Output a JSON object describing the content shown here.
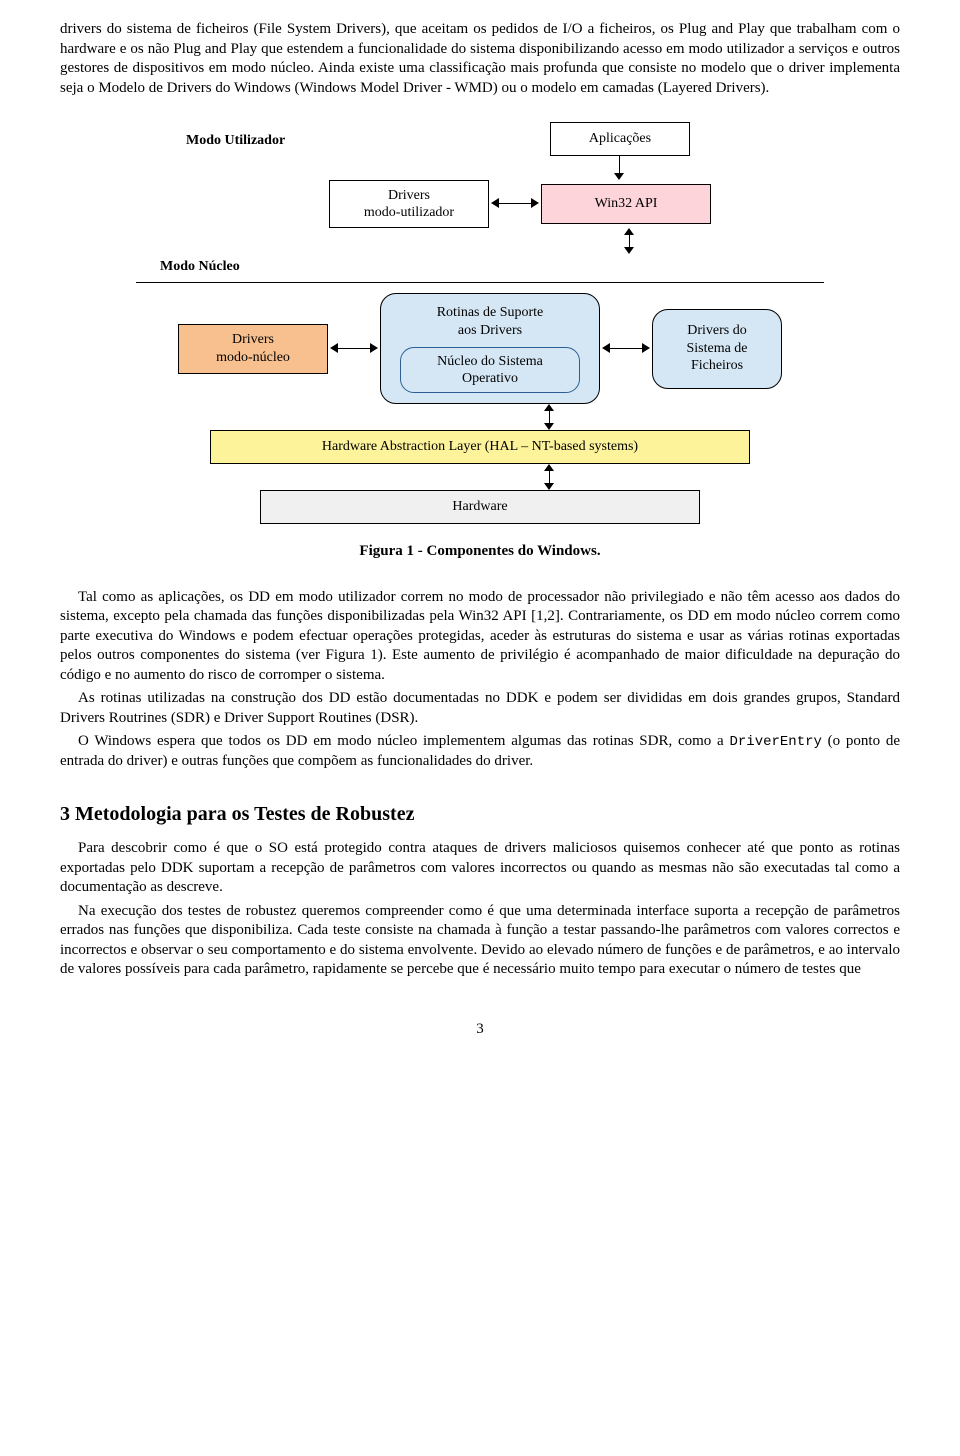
{
  "p1_first": "drivers do sistema de ficheiros (File System Drivers), que aceitam os pedidos de I/O a ficheiros, os Plug and Play que trabalham com o hardware e os não Plug and Play que estendem a funcionalidade do sistema disponibilizando acesso em modo utilizador a serviços e outros gestores de dispositivos em modo núcleo. Ainda existe uma classificação mais profunda que consiste no modelo que o driver implementa seja o Modelo de Drivers do Windows (Windows Model Driver - WMD) ou o modelo em camadas (Layered Drivers).",
  "diagram": {
    "mode_user": "Modo Utilizador",
    "mode_kernel": "Modo Núcleo",
    "apps": "Aplicações",
    "user_drivers_l1": "Drivers",
    "user_drivers_l2": "modo-utilizador",
    "win32": "Win32  API",
    "kern_drivers_l1": "Drivers",
    "kern_drivers_l2": "modo-núcleo",
    "support_l1": "Rotinas de Suporte",
    "support_l2": "aos Drivers",
    "nucleus_l1": "Núcleo do Sistema",
    "nucleus_l2": "Operativo",
    "fs_l1": "Drivers do",
    "fs_l2": "Sistema de",
    "fs_l3": "Ficheiros",
    "hal": "Hardware Abstraction Layer (HAL – NT-based systems)",
    "hardware": "Hardware"
  },
  "fig_caption": "Figura 1 - Componentes do Windows.",
  "p2": "Tal como as aplicações, os DD em modo utilizador correm no modo de processador não privilegiado e não têm acesso aos dados do sistema, excepto pela chamada das funções disponibilizadas pela Win32 API [1,2]. Contrariamente, os DD em modo núcleo correm como parte executiva do Windows e podem efectuar operações protegidas, aceder às estruturas do sistema e usar as várias rotinas exportadas pelos outros componentes do sistema (ver Figura 1). Este aumento de privilégio é acompanhado de maior dificuldade na depuração do código e no aumento do risco de corromper o sistema.",
  "p3": "As rotinas utilizadas na construção dos DD estão documentadas no DDK e podem ser divididas em dois grandes grupos, Standard Drivers Routrines (SDR) e Driver Support Routines (DSR).",
  "p4_a": "O Windows espera que todos os DD em modo núcleo implementem algumas das rotinas SDR, como a ",
  "p4_code": "DriverEntry",
  "p4_b": " (o ponto de entrada do driver) e outras funções que compõem as funcionalidades do driver.",
  "section3": "3 Metodologia para os Testes de Robustez",
  "p5": "Para descobrir como é que o SO está protegido contra ataques de drivers maliciosos quisemos conhecer até que ponto as rotinas exportadas pelo DDK suportam a recepção de parâmetros com valores incorrectos ou quando as mesmas não são executadas tal como a documentação as descreve.",
  "p6": "Na execução dos testes de robustez queremos compreender como é que uma determinada interface suporta a recepção de parâmetros errados nas funções que disponibiliza. Cada teste consiste na chamada à função a testar passando-lhe parâmetros com valores correctos e incorrectos e observar o seu comportamento e do sistema envolvente. Devido ao elevado número de funções e de parâmetros, e ao intervalo de valores possíveis para cada parâmetro, rapidamente se percebe que é necessário muito tempo para executar o número de testes que",
  "page_number": "3"
}
